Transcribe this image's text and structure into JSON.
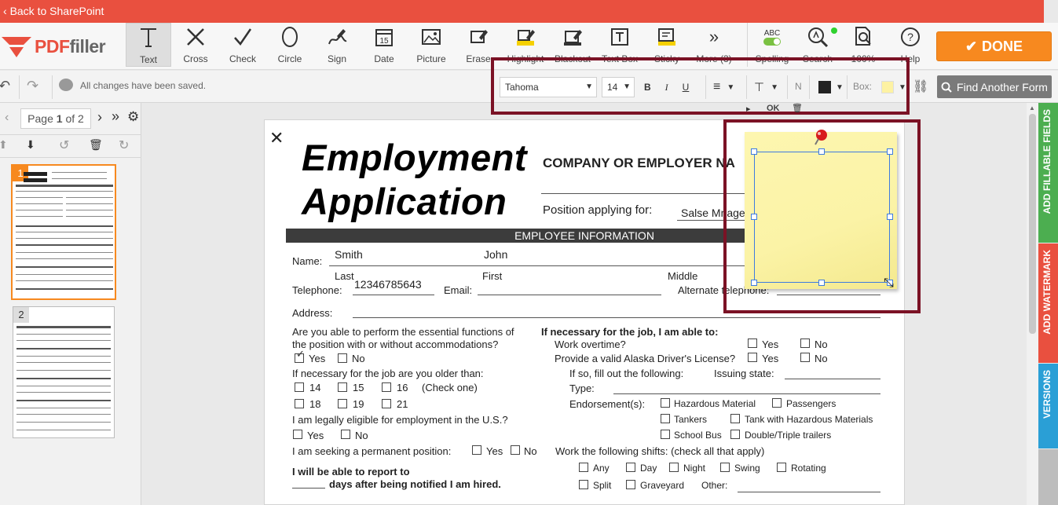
{
  "topbar": {
    "back_label": "Back to SharePoint"
  },
  "logo": {
    "brand_pdf": "PDF",
    "brand_filler": "filler"
  },
  "tools": [
    {
      "label": "Text",
      "icon": "text-icon"
    },
    {
      "label": "Cross",
      "icon": "cross-icon"
    },
    {
      "label": "Check",
      "icon": "check-icon"
    },
    {
      "label": "Circle",
      "icon": "circle-icon"
    },
    {
      "label": "Sign",
      "icon": "sign-icon"
    },
    {
      "label": "Date",
      "icon": "date-icon"
    },
    {
      "label": "Picture",
      "icon": "picture-icon"
    },
    {
      "label": "Erase",
      "icon": "erase-icon"
    },
    {
      "label": "Highlight",
      "icon": "highlight-icon"
    },
    {
      "label": "Blackout",
      "icon": "blackout-icon"
    },
    {
      "label": "Text Box",
      "icon": "textbox-icon"
    },
    {
      "label": "Sticky",
      "icon": "sticky-icon"
    },
    {
      "label": "More (3)",
      "icon": "more-icon"
    },
    {
      "label": "Spelling",
      "icon": "spelling-icon",
      "badge": "ABC"
    },
    {
      "label": "Search",
      "icon": "search-icon"
    },
    {
      "label": "100%",
      "icon": "zoom-icon"
    },
    {
      "label": "Help",
      "icon": "help-icon"
    }
  ],
  "done_label": "DONE",
  "bar2": {
    "saved_text": "All changes have been saved.",
    "font": "Tahoma",
    "size": "14",
    "bold": "B",
    "italic": "I",
    "underline": "U",
    "n_label": "N",
    "box_label": "Box:",
    "find_label": "Find Another Form"
  },
  "pager": {
    "page_word": "Page",
    "current": "1",
    "of_text": "of 2"
  },
  "thumbs": [
    {
      "num": "1"
    },
    {
      "num": "2"
    }
  ],
  "sticky_toolbar": {
    "ok": "OK"
  },
  "doc": {
    "title1": "Employment",
    "title2": "Application",
    "company": "COMPANY OR EMPLOYER NA",
    "position_label": "Position applying for:",
    "position_value": "Salse Mnager",
    "section": "EMPLOYEE INFORMATION",
    "name_label": "Name:",
    "last_value": "Smith",
    "first_value": "John",
    "last_label": "Last",
    "first_label": "First",
    "middle_label": "Middle",
    "tel_label": "Telephone:",
    "tel_value": "12346785643",
    "email_label": "Email:",
    "alt_tel_label": "Alternate telephone:",
    "address_label": "Address:",
    "q1a": "Are you able to perform the essential functions of",
    "q1b": "the position with or without accommodations?",
    "yes": "Yes",
    "no": "No",
    "q2": "If necessary for the job are you older than:",
    "ages": [
      "14",
      "15",
      "16",
      "18",
      "19",
      "21"
    ],
    "check_one": "(Check one)",
    "q3": "I am legally eligible for employment in the U.S.?",
    "q4": "I am seeking a permanent position:",
    "q5a": "I will be able to report to",
    "q5b": "days after being notified I am hired.",
    "r_head": "If necessary for the job, I am able to:",
    "r1": "Work overtime?",
    "r2": "Provide a valid Alaska Driver's License?",
    "r3": "If so, fill out the following:",
    "issuing": "Issuing state:",
    "type": "Type:",
    "endorse": "Endorsement(s):",
    "e_haz": "Hazardous Material",
    "e_pass": "Passengers",
    "e_tank": "Tankers",
    "e_tankhaz": "Tank with Hazardous Materials",
    "e_bus": "School Bus",
    "e_double": "Double/Triple trailers",
    "shifts": "Work the following shifts: (check all that apply)",
    "s_any": "Any",
    "s_day": "Day",
    "s_night": "Night",
    "s_swing": "Swing",
    "s_rot": "Rotating",
    "s_split": "Split",
    "s_grave": "Graveyard",
    "s_other": "Other:"
  },
  "right_tabs": [
    {
      "label": "ADD FILLABLE FIELDS",
      "color": "#4cae50"
    },
    {
      "label": "ADD WATERMARK",
      "color": "#e9503f"
    },
    {
      "label": "VERSIONS",
      "color": "#2a9fd6"
    }
  ]
}
